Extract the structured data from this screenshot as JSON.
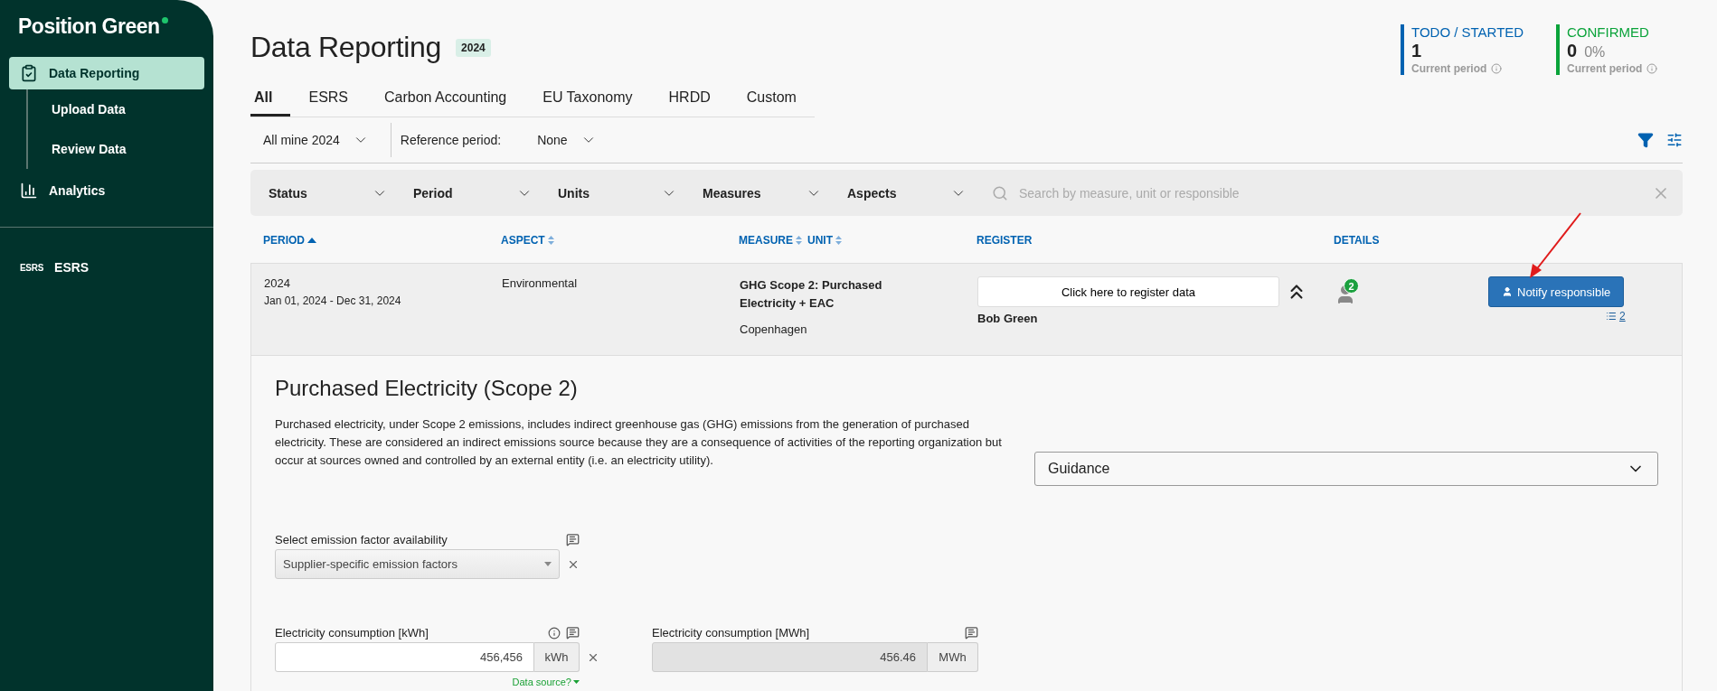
{
  "sidebar": {
    "logo": "Position Green",
    "items": [
      {
        "label": "Data Reporting",
        "selected": true,
        "children": [
          {
            "label": "Upload Data",
            "selected": false
          },
          {
            "label": "Review Data",
            "selected": false
          }
        ]
      },
      {
        "label": "Analytics",
        "selected": false
      }
    ],
    "section_items": [
      {
        "label": "ESRS",
        "badge": "ESRS",
        "selected": false
      }
    ]
  },
  "header": {
    "title": "Data Reporting",
    "year_badge": "2024",
    "stats": [
      {
        "label": "TODO / STARTED",
        "value": "1",
        "caption": "Current period",
        "color": "#0062b1"
      },
      {
        "label": "CONFIRMED",
        "value": "0",
        "percent": "0%",
        "caption": "Current period",
        "color": "#0aa33a"
      }
    ]
  },
  "tabs": [
    {
      "label": "All",
      "selected": true
    },
    {
      "label": "ESRS",
      "selected": false
    },
    {
      "label": "Carbon Accounting",
      "selected": false
    },
    {
      "label": "EU Taxonomy",
      "selected": false
    },
    {
      "label": "HRDD",
      "selected": false
    },
    {
      "label": "Custom",
      "selected": false
    }
  ],
  "period_filter": {
    "value": "All mine 2024",
    "reference_label": "Reference period:",
    "reference_value": "None"
  },
  "filter_bar": {
    "dropdowns": [
      "Status",
      "Period",
      "Units",
      "Measures",
      "Aspects"
    ],
    "search_placeholder": "Search by measure, unit or responsible"
  },
  "table": {
    "columns": [
      {
        "label": "PERIOD",
        "sortable": true,
        "sorted": true
      },
      {
        "label": "ASPECT",
        "sortable": true
      },
      {
        "label": "MEASURE",
        "sortable": true
      },
      {
        "label": "UNIT",
        "sortable": true
      },
      {
        "label": "REGISTER",
        "sortable": false
      },
      {
        "label": "DETAILS",
        "sortable": false
      }
    ],
    "rows": [
      {
        "period": "2024",
        "period_range": "Jan 01, 2024 - Dec 31, 2024",
        "aspect": "Environmental",
        "measure": "GHG Scope 2: Purchased Electricity + EAC",
        "location": "Copenhagen",
        "register_button": "Click here to register data",
        "responsible": "Bob Green",
        "details_count": "2",
        "notify_button": "Notify responsible",
        "link_count": "2",
        "expanded": true
      }
    ]
  },
  "detail": {
    "title": "Purchased Electricity (Scope 2)",
    "description": "Purchased electricity, under Scope 2 emissions, includes indirect greenhouse gas (GHG) emissions from the generation of purchased electricity. These are considered an indirect emissions source because they are a consequence of activities of the reporting organization but occur at sources owned and controlled by an external entity (i.e. an electricity utility).",
    "guidance": "Guidance",
    "select_field": {
      "label": "Select emission factor availability",
      "value": "Supplier-specific emission factors"
    },
    "inputs": [
      {
        "label": "Electricity consumption [kWh]",
        "value": "456,456",
        "unit": "kWh",
        "disabled": false,
        "data_source": "Data source?"
      },
      {
        "label": "Electricity consumption [MWh]",
        "value": "456.46",
        "unit": "MWh",
        "disabled": true
      }
    ]
  }
}
